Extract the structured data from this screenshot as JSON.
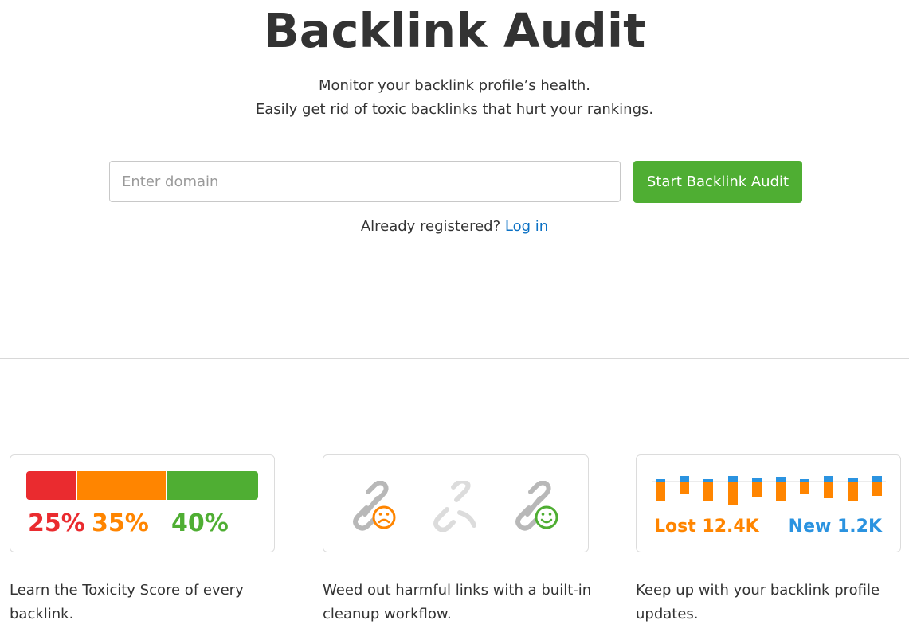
{
  "hero": {
    "title": "Backlink Audit",
    "subtitle_line1": "Monitor your backlink profile’s health.",
    "subtitle_line2": "Easily get rid of toxic backlinks that hurt your rankings."
  },
  "form": {
    "domain_placeholder": "Enter domain",
    "domain_value": "",
    "start_button_label": "Start Backlink Audit",
    "already_registered": "Already registered?",
    "login_link": "Log in"
  },
  "colors": {
    "accent_green": "#4fae33",
    "red": "#ea2b2f",
    "orange": "#ff8500",
    "blue": "#2b93e0",
    "link": "#0b71c4"
  },
  "features": [
    {
      "toxicity": {
        "segments": [
          {
            "label": "25%",
            "value": 25,
            "color": "#ea2b2f"
          },
          {
            "label": "35%",
            "value": 35,
            "color": "#ff8500"
          },
          {
            "label": "40%",
            "value": 40,
            "color": "#4fae33"
          }
        ]
      },
      "text": "Learn the Toxicity Score of every backlink."
    },
    {
      "icons": [
        "broken-link-sad-icon",
        "broken-link-icon",
        "link-happy-icon"
      ],
      "text": "Weed out harmful links with a built-in cleanup workflow."
    },
    {
      "lost_label": "Lost 12.4K",
      "new_label": "New 1.2K",
      "text": "Keep up with your backlink profile updates."
    }
  ]
}
